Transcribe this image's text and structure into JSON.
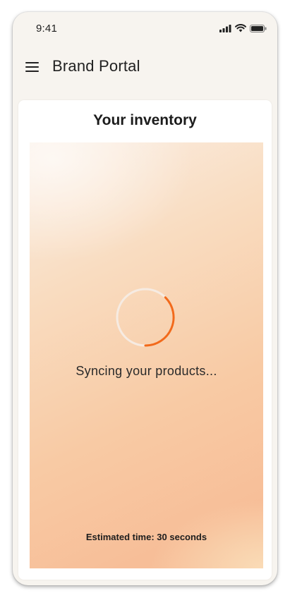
{
  "status_bar": {
    "time": "9:41",
    "icons": [
      "signal-icon",
      "wifi-icon",
      "battery-icon"
    ]
  },
  "header": {
    "menu_icon": "hamburger-menu-icon",
    "title": "Brand Portal"
  },
  "card": {
    "title": "Your inventory",
    "sync": {
      "spinner_icon": "loading-spinner-icon",
      "message": "Syncing your products...",
      "estimate": "Estimated time: 30 seconds"
    }
  },
  "colors": {
    "accent": "#f26a1b",
    "background": "#f7f4ef",
    "panel_gradient": [
      "#faeee3",
      "#f8caa4",
      "#f7be98"
    ]
  }
}
